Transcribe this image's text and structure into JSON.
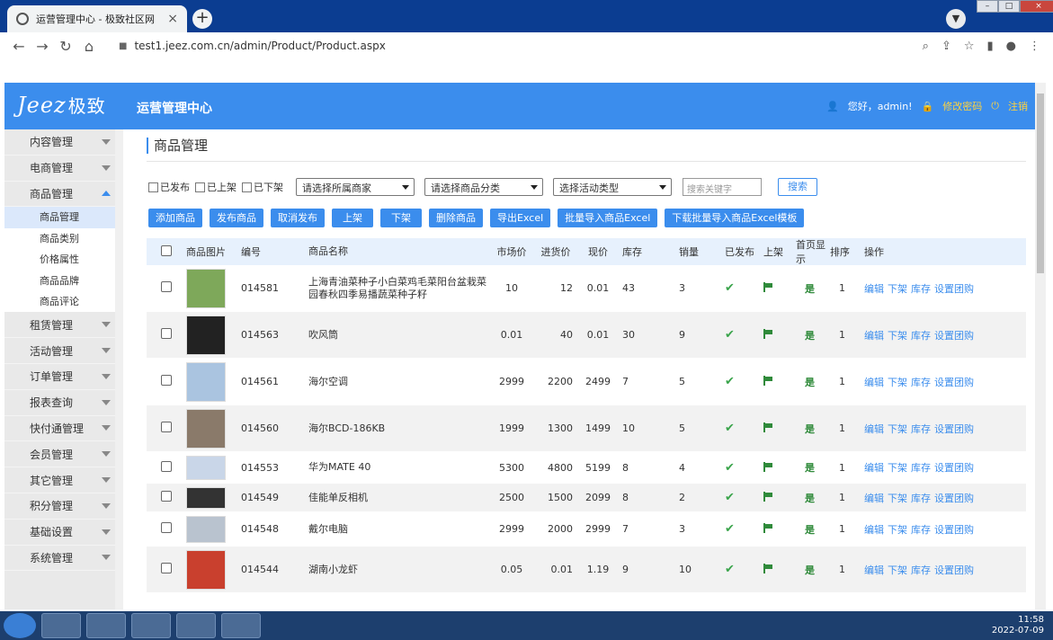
{
  "browser": {
    "tab_title": "运营管理中心 - 极致社区网",
    "url": "test1.jeez.com.cn/admin/Product/Product.aspx"
  },
  "header": {
    "logo_text": "Jeez",
    "logo_cn": "极致",
    "system_title": "运营管理中心",
    "greeting": "您好，admin!",
    "change_password": "修改密码",
    "logout": "注销"
  },
  "sidebar": {
    "items": [
      {
        "label": "内容管理"
      },
      {
        "label": "电商管理"
      },
      {
        "label": "商品管理"
      },
      {
        "label": "租赁管理"
      },
      {
        "label": "活动管理"
      },
      {
        "label": "订单管理"
      },
      {
        "label": "报表查询"
      },
      {
        "label": "快付通管理"
      },
      {
        "label": "会员管理"
      },
      {
        "label": "其它管理"
      },
      {
        "label": "积分管理"
      },
      {
        "label": "基础设置"
      },
      {
        "label": "系统管理"
      }
    ],
    "sub_items": [
      {
        "label": "商品管理"
      },
      {
        "label": "商品类别"
      },
      {
        "label": "价格属性"
      },
      {
        "label": "商品品牌"
      },
      {
        "label": "商品评论"
      }
    ]
  },
  "page": {
    "title": "商品管理",
    "filters": {
      "published": "已发布",
      "on_shelf": "已上架",
      "off_shelf": "已下架",
      "merchant_select": "请选择所属商家",
      "category_select": "请选择商品分类",
      "activity_select": "选择活动类型",
      "keyword_placeholder": "搜索关键字",
      "search_button": "搜索"
    },
    "actions": [
      "添加商品",
      "发布商品",
      "取消发布",
      "上架",
      "下架",
      "删除商品",
      "导出Excel",
      "批量导入商品Excel",
      "下载批量导入商品Excel模板"
    ]
  },
  "table": {
    "headers": [
      "商品图片",
      "编号",
      "商品名称",
      "市场价",
      "进货价",
      "现价",
      "库存",
      "销量",
      "已发布",
      "上架",
      "首页显示",
      "排序",
      "操作"
    ],
    "rows": [
      {
        "no": "014581",
        "name": "上海青油菜种子小白菜鸡毛菜阳台盆栽菜园春秋四季易播蔬菜种子籽",
        "market": "10",
        "cost": "12",
        "price": "0.01",
        "stock": "43",
        "sales": "3",
        "home": "是",
        "sort": "1",
        "img_color": "#7ea85a"
      },
      {
        "no": "014563",
        "name": "吹风筒",
        "market": "0.01",
        "cost": "40",
        "price": "0.01",
        "stock": "30",
        "sales": "9",
        "home": "是",
        "sort": "1",
        "img_color": "#222222"
      },
      {
        "no": "014561",
        "name": "海尔空调",
        "market": "2999",
        "cost": "2200",
        "price": "2499",
        "stock": "7",
        "sales": "5",
        "home": "是",
        "sort": "1",
        "img_color": "#aac4e0"
      },
      {
        "no": "014560",
        "name": "海尔BCD-186KB",
        "market": "1999",
        "cost": "1300",
        "price": "1499",
        "stock": "10",
        "sales": "5",
        "home": "是",
        "sort": "1",
        "img_color": "#8a7a6a"
      },
      {
        "no": "014553",
        "name": "华为MATE 40",
        "market": "5300",
        "cost": "4800",
        "price": "5199",
        "stock": "8",
        "sales": "4",
        "home": "是",
        "sort": "1",
        "img_color": "#c9d6e8"
      },
      {
        "no": "014549",
        "name": "佳能单反相机",
        "market": "2500",
        "cost": "1500",
        "price": "2099",
        "stock": "8",
        "sales": "2",
        "home": "是",
        "sort": "1",
        "img_color": "#333333"
      },
      {
        "no": "014548",
        "name": "戴尔电脑",
        "market": "2999",
        "cost": "2000",
        "price": "2999",
        "stock": "7",
        "sales": "3",
        "home": "是",
        "sort": "1",
        "img_color": "#b9c3cf"
      },
      {
        "no": "014544",
        "name": "湖南小龙虾",
        "market": "0.05",
        "cost": "0.01",
        "price": "1.19",
        "stock": "9",
        "sales": "10",
        "home": "是",
        "sort": "1",
        "img_color": "#c9402e"
      }
    ],
    "op_links": [
      "编辑",
      "下架",
      "库存",
      "设置团购"
    ]
  },
  "taskbar": {
    "time": "11:58",
    "date": "2022-07-09"
  }
}
